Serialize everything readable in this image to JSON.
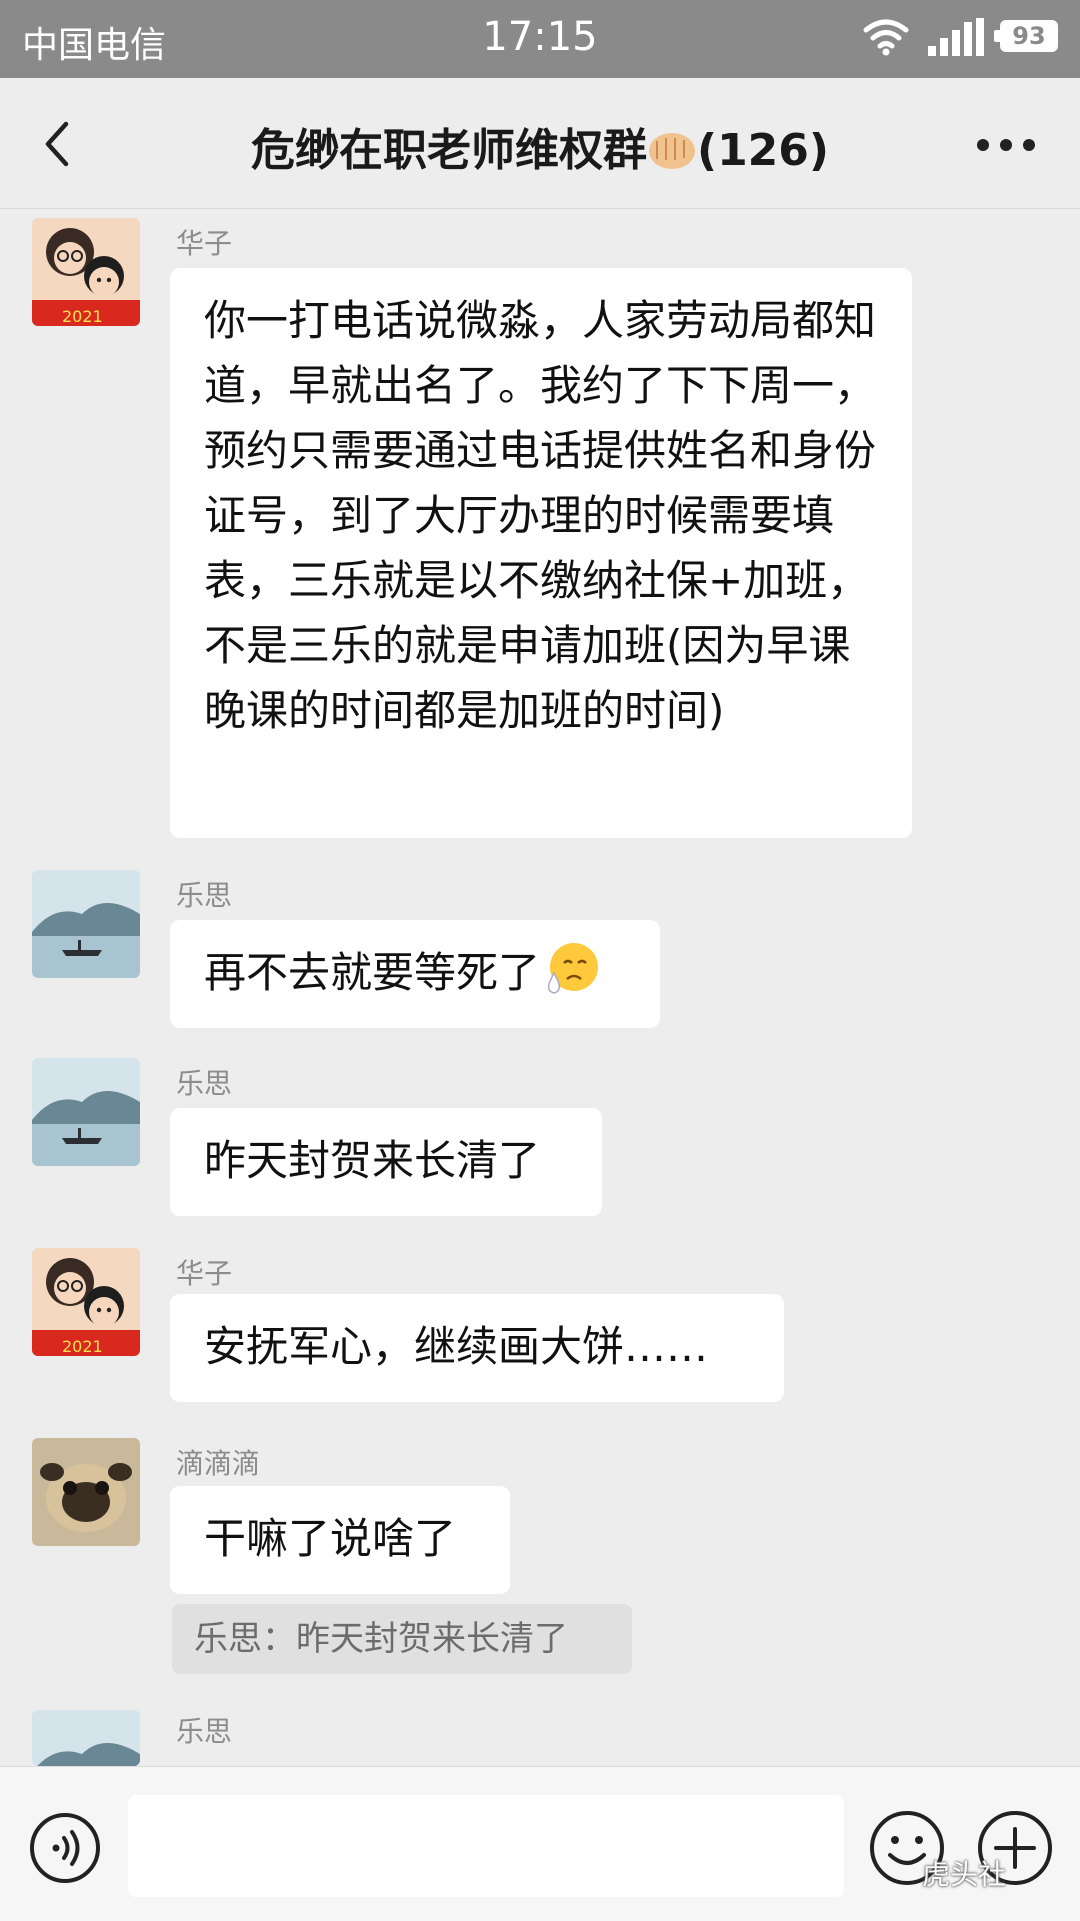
{
  "status_bar": {
    "carrier": "中国电信",
    "time": "17:15",
    "battery": "93"
  },
  "header": {
    "title": "危缈在职老师维权群",
    "member_count": "(126)",
    "title_emoji": "fist-emoji"
  },
  "messages": [
    {
      "sender": "华子",
      "avatar": "cartoon-couple-avatar",
      "text": "你一打电话说微淼，人家劳动局都知道，早就出名了。我约了下下周一，预约只需要通过电话提供姓名和身份证号，到了大厅办理的时候需要填表，三乐就是以不缴纳社保+加班，不是三乐的就是申请加班(因为早课晚课的时间都是加班的时间)"
    },
    {
      "sender": "乐思",
      "avatar": "lake-boat-avatar",
      "text": "再不去就要等死了",
      "emoji": "sad-sweat-emoji"
    },
    {
      "sender": "乐思",
      "avatar": "lake-boat-avatar",
      "text": "昨天封贺来长清了"
    },
    {
      "sender": "华子",
      "avatar": "cartoon-couple-avatar",
      "text": "安抚军心，继续画大饼……"
    },
    {
      "sender": "滴滴滴",
      "avatar": "pug-dog-avatar",
      "text": "干嘛了说啥了",
      "quote": "乐思：昨天封贺来长清了"
    },
    {
      "sender": "乐思",
      "avatar": "lake-boat-avatar",
      "text": ""
    }
  ],
  "watermark": "虎头社",
  "colors": {
    "background": "#ededed",
    "bubble": "#ffffff",
    "status_bar": "#8a8a8a"
  }
}
